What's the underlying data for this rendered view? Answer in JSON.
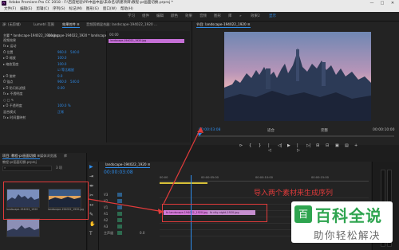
{
  "window": {
    "app_icon_text": "Pr",
    "title": "Adobe Premiere Pro CC 2018 - F:\\百度经验\\PR中画中画\\未命名\\新建项目\\教程-pr画面切换.prproj *",
    "minimize_label": "—",
    "maximize_label": "□",
    "close_label": "✕"
  },
  "menubar": {
    "items": [
      "文件(F)",
      "编辑(E)",
      "剪辑(C)",
      "序列(S)",
      "标记(M)",
      "图形(G)",
      "窗口(W)",
      "帮助(H)"
    ]
  },
  "workspace": {
    "tabs": [
      "学习",
      "组件",
      "编辑",
      "颜色",
      "效果",
      "音频",
      "图形",
      "库",
      "»",
      "效果2",
      "显示"
    ],
    "active": "显示"
  },
  "effect_controls": {
    "tabs": [
      "源: (无剪辑)",
      "Lumetri 范围",
      "效果控件 ≡",
      "音频剪辑混合器: landscape-194022_1920 ..."
    ],
    "source_label": "主要 * landscape-194022_1920.jpg",
    "sequence_label": "landscape-194022_1920 * landscape-19...",
    "section_video": "视频效果",
    "rows": [
      {
        "label": "fx ▸ 运动",
        "v1": "",
        "v2": ""
      },
      {
        "label": "Ö 位置",
        "v1": "960.0",
        "v2": "540.0"
      },
      {
        "label": "▸ Ö 缩放",
        "v1": "100.0",
        "v2": ""
      },
      {
        "label": "▸ 缩放宽度",
        "v1": "100.0",
        "v2": ""
      },
      {
        "label": "",
        "v1": "☑ 等比缩放",
        "v2": ""
      },
      {
        "label": "▸ Ö 旋转",
        "v1": "0.0",
        "v2": ""
      },
      {
        "label": "Ö 锚点",
        "v1": "960.0",
        "v2": "540.0"
      },
      {
        "label": "▸ Ö 防闪烁滤镜",
        "v1": "0.00",
        "v2": ""
      },
      {
        "label": "fx ▸ 不透明度",
        "v1": "",
        "v2": ""
      },
      {
        "label": "○ □ ✎",
        "v1": "",
        "v2": ""
      },
      {
        "label": "▸ Ö 不透明度",
        "v1": "100.0 %",
        "v2": ""
      },
      {
        "label": "混合模式",
        "v1": "正常",
        "v2": ""
      },
      {
        "label": "fx ▸ 时间重映射",
        "v1": "",
        "v2": ""
      }
    ],
    "mini_time": "00:00",
    "mini_clip": "landscape-194022_1920.jpg"
  },
  "program_monitor": {
    "title": "节目: landscape-194022_1920 ≡",
    "current_time": "00:00:03:08",
    "fit_label": "适合",
    "quality": "完整",
    "duration": "00:00:10:00"
  },
  "transport": {
    "buttons": [
      "⊳",
      "{",
      "}",
      "|◁",
      "◁|",
      "▶",
      "|▷",
      "▷|",
      "⊞",
      "⊟",
      "▣",
      "▤",
      "+"
    ]
  },
  "project_panel": {
    "tabs": [
      "项目: 教程-pr画面切换 ≡",
      "媒体浏览器",
      "库"
    ],
    "search_placeholder": "",
    "count_label": "3 项",
    "folder_label": "教程-pr画面切换.prproj",
    "items": [
      {
        "name": "landscape-194022_1920",
        "duration": "5:00"
      },
      {
        "name": "landscape-194022_1920.jpg",
        "duration": "5:00"
      },
      {
        "name": "city-night-1920.jpg",
        "duration": "5:00"
      }
    ]
  },
  "timeline": {
    "tab": "landscape-194022_1920 ≡",
    "current_time": "00:00:03:08",
    "ruler": [
      "00:00",
      "00:00:05:00",
      "00:00:10:00",
      "00:00:15:00"
    ],
    "tracks": [
      {
        "name": "V3",
        "kind": "video"
      },
      {
        "name": "V2",
        "kind": "video"
      },
      {
        "name": "V1",
        "kind": "video"
      },
      {
        "name": "A1",
        "kind": "audio"
      },
      {
        "name": "A2",
        "kind": "audio"
      },
      {
        "name": "A3",
        "kind": "audio"
      },
      {
        "name": "主声道",
        "kind": "master",
        "value": "0.0"
      }
    ],
    "clips": [
      {
        "label": "fx landscape-194022_1920.jpg",
        "color": "#d27ad6"
      },
      {
        "label": "fx city-night-1920.jpg",
        "color": "#d27ad6"
      }
    ]
  },
  "annotation": "导入两个素材来生成序列",
  "watermark": {
    "icon": "百",
    "title": "百科全说",
    "subtitle": "助你轻松解决"
  }
}
